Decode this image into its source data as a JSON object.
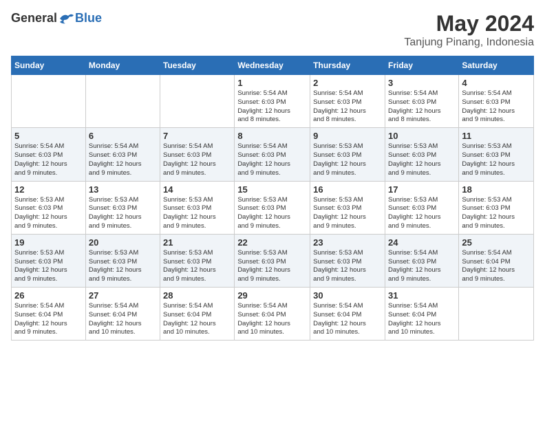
{
  "logo": {
    "general": "General",
    "blue": "Blue"
  },
  "title": "May 2024",
  "location": "Tanjung Pinang, Indonesia",
  "weekdays": [
    "Sunday",
    "Monday",
    "Tuesday",
    "Wednesday",
    "Thursday",
    "Friday",
    "Saturday"
  ],
  "weeks": [
    [
      {
        "day": "",
        "info": ""
      },
      {
        "day": "",
        "info": ""
      },
      {
        "day": "",
        "info": ""
      },
      {
        "day": "1",
        "info": "Sunrise: 5:54 AM\nSunset: 6:03 PM\nDaylight: 12 hours\nand 8 minutes."
      },
      {
        "day": "2",
        "info": "Sunrise: 5:54 AM\nSunset: 6:03 PM\nDaylight: 12 hours\nand 8 minutes."
      },
      {
        "day": "3",
        "info": "Sunrise: 5:54 AM\nSunset: 6:03 PM\nDaylight: 12 hours\nand 8 minutes."
      },
      {
        "day": "4",
        "info": "Sunrise: 5:54 AM\nSunset: 6:03 PM\nDaylight: 12 hours\nand 9 minutes."
      }
    ],
    [
      {
        "day": "5",
        "info": "Sunrise: 5:54 AM\nSunset: 6:03 PM\nDaylight: 12 hours\nand 9 minutes."
      },
      {
        "day": "6",
        "info": "Sunrise: 5:54 AM\nSunset: 6:03 PM\nDaylight: 12 hours\nand 9 minutes."
      },
      {
        "day": "7",
        "info": "Sunrise: 5:54 AM\nSunset: 6:03 PM\nDaylight: 12 hours\nand 9 minutes."
      },
      {
        "day": "8",
        "info": "Sunrise: 5:54 AM\nSunset: 6:03 PM\nDaylight: 12 hours\nand 9 minutes."
      },
      {
        "day": "9",
        "info": "Sunrise: 5:53 AM\nSunset: 6:03 PM\nDaylight: 12 hours\nand 9 minutes."
      },
      {
        "day": "10",
        "info": "Sunrise: 5:53 AM\nSunset: 6:03 PM\nDaylight: 12 hours\nand 9 minutes."
      },
      {
        "day": "11",
        "info": "Sunrise: 5:53 AM\nSunset: 6:03 PM\nDaylight: 12 hours\nand 9 minutes."
      }
    ],
    [
      {
        "day": "12",
        "info": "Sunrise: 5:53 AM\nSunset: 6:03 PM\nDaylight: 12 hours\nand 9 minutes."
      },
      {
        "day": "13",
        "info": "Sunrise: 5:53 AM\nSunset: 6:03 PM\nDaylight: 12 hours\nand 9 minutes."
      },
      {
        "day": "14",
        "info": "Sunrise: 5:53 AM\nSunset: 6:03 PM\nDaylight: 12 hours\nand 9 minutes."
      },
      {
        "day": "15",
        "info": "Sunrise: 5:53 AM\nSunset: 6:03 PM\nDaylight: 12 hours\nand 9 minutes."
      },
      {
        "day": "16",
        "info": "Sunrise: 5:53 AM\nSunset: 6:03 PM\nDaylight: 12 hours\nand 9 minutes."
      },
      {
        "day": "17",
        "info": "Sunrise: 5:53 AM\nSunset: 6:03 PM\nDaylight: 12 hours\nand 9 minutes."
      },
      {
        "day": "18",
        "info": "Sunrise: 5:53 AM\nSunset: 6:03 PM\nDaylight: 12 hours\nand 9 minutes."
      }
    ],
    [
      {
        "day": "19",
        "info": "Sunrise: 5:53 AM\nSunset: 6:03 PM\nDaylight: 12 hours\nand 9 minutes."
      },
      {
        "day": "20",
        "info": "Sunrise: 5:53 AM\nSunset: 6:03 PM\nDaylight: 12 hours\nand 9 minutes."
      },
      {
        "day": "21",
        "info": "Sunrise: 5:53 AM\nSunset: 6:03 PM\nDaylight: 12 hours\nand 9 minutes."
      },
      {
        "day": "22",
        "info": "Sunrise: 5:53 AM\nSunset: 6:03 PM\nDaylight: 12 hours\nand 9 minutes."
      },
      {
        "day": "23",
        "info": "Sunrise: 5:53 AM\nSunset: 6:03 PM\nDaylight: 12 hours\nand 9 minutes."
      },
      {
        "day": "24",
        "info": "Sunrise: 5:54 AM\nSunset: 6:03 PM\nDaylight: 12 hours\nand 9 minutes."
      },
      {
        "day": "25",
        "info": "Sunrise: 5:54 AM\nSunset: 6:04 PM\nDaylight: 12 hours\nand 9 minutes."
      }
    ],
    [
      {
        "day": "26",
        "info": "Sunrise: 5:54 AM\nSunset: 6:04 PM\nDaylight: 12 hours\nand 9 minutes."
      },
      {
        "day": "27",
        "info": "Sunrise: 5:54 AM\nSunset: 6:04 PM\nDaylight: 12 hours\nand 10 minutes."
      },
      {
        "day": "28",
        "info": "Sunrise: 5:54 AM\nSunset: 6:04 PM\nDaylight: 12 hours\nand 10 minutes."
      },
      {
        "day": "29",
        "info": "Sunrise: 5:54 AM\nSunset: 6:04 PM\nDaylight: 12 hours\nand 10 minutes."
      },
      {
        "day": "30",
        "info": "Sunrise: 5:54 AM\nSunset: 6:04 PM\nDaylight: 12 hours\nand 10 minutes."
      },
      {
        "day": "31",
        "info": "Sunrise: 5:54 AM\nSunset: 6:04 PM\nDaylight: 12 hours\nand 10 minutes."
      },
      {
        "day": "",
        "info": ""
      }
    ]
  ]
}
